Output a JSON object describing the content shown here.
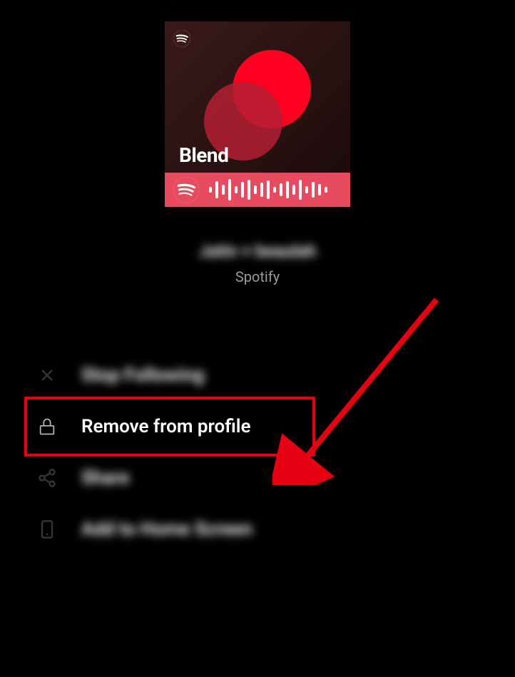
{
  "cover": {
    "label": "Blend"
  },
  "playlist": {
    "title": "Jatin + beaulah",
    "subtitle": "Spotify"
  },
  "menu": {
    "stop_following": "Stop Following",
    "remove_from_profile": "Remove from profile",
    "share": "Share",
    "add_home": "Add to Home Screen"
  },
  "colors": {
    "highlight": "#e60012",
    "code_bg": "#e84a5f"
  }
}
